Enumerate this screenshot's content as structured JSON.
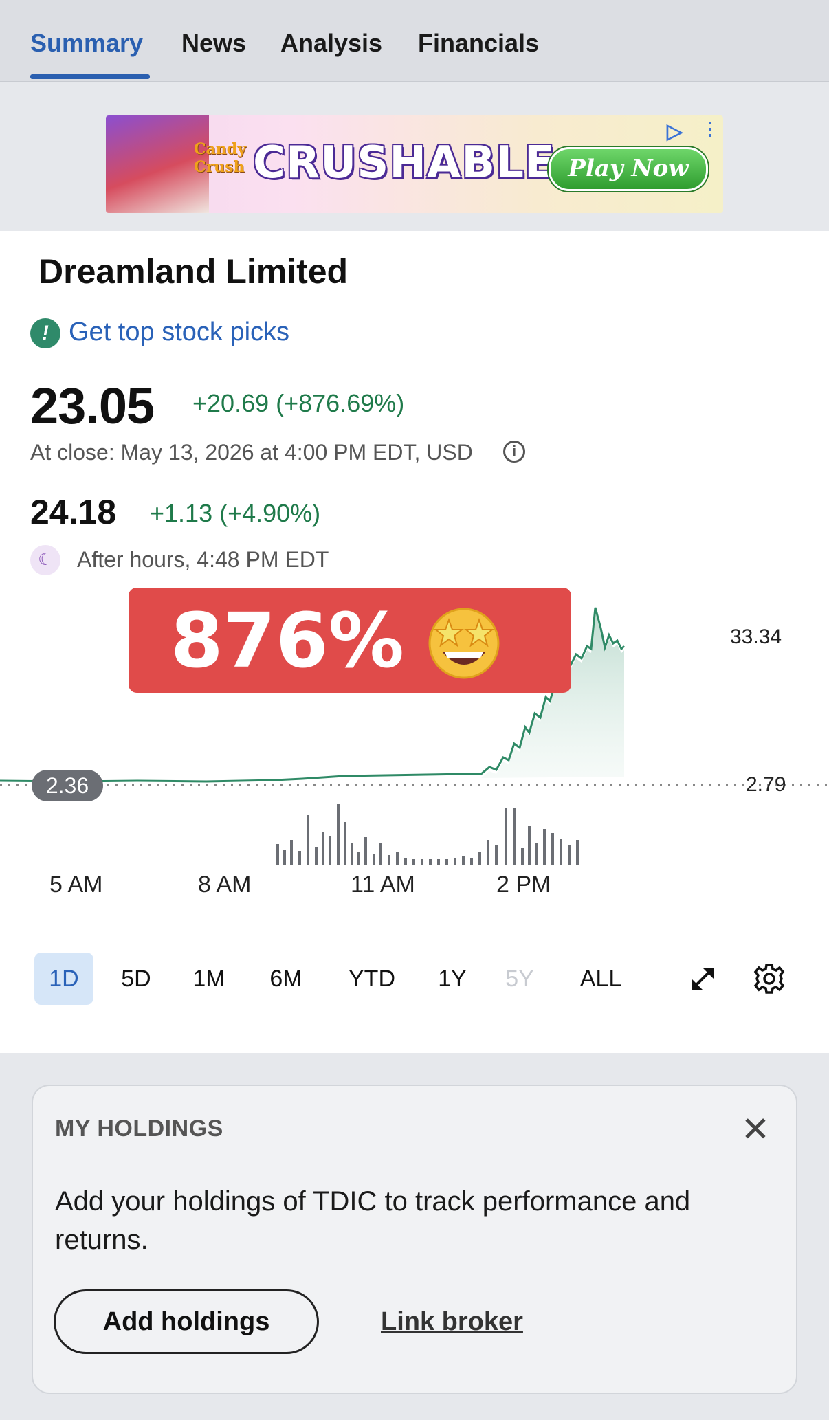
{
  "tabs": [
    "Summary",
    "News",
    "Analysis",
    "Financials"
  ],
  "ad": {
    "logo": "Candy Crush",
    "headline": "CRUSHABLE",
    "cta": "Play Now"
  },
  "stock": {
    "name": "Dreamland Limited",
    "picks_link": "Get top stock picks",
    "price": "23.05",
    "change": "+20.69 (+876.69%)",
    "close_info": "At close: May 13, 2026 at 4:00 PM EDT, USD",
    "after_hours_price": "24.18",
    "after_hours_change": "+1.13 (+4.90%)",
    "after_hours_label": "After hours, 4:48 PM EDT"
  },
  "overlay": {
    "text": "876%",
    "emoji": "star-struck-emoji"
  },
  "chart": {
    "high_label": "33.34",
    "last_label": "2.79",
    "prev_close_label": "2.36",
    "x_labels": [
      "5 AM",
      "8 AM",
      "11 AM",
      "2 PM"
    ]
  },
  "ranges": [
    {
      "label": "1D",
      "state": "active"
    },
    {
      "label": "5D",
      "state": "normal"
    },
    {
      "label": "1M",
      "state": "normal"
    },
    {
      "label": "6M",
      "state": "normal"
    },
    {
      "label": "YTD",
      "state": "normal"
    },
    {
      "label": "1Y",
      "state": "normal"
    },
    {
      "label": "5Y",
      "state": "disabled"
    },
    {
      "label": "ALL",
      "state": "normal"
    }
  ],
  "icons": {
    "expand": "expand-icon",
    "settings": "gear-icon",
    "info": "info-icon",
    "close": "close-icon",
    "after_hours": "moon-icon"
  },
  "holdings": {
    "title": "MY HOLDINGS",
    "description": "Add your holdings of TDIC to track performance and returns.",
    "add_button": "Add holdings",
    "link_broker": "Link broker"
  },
  "colors": {
    "accent": "#2a5fb0",
    "positive": "#1f7a4a",
    "banner": "#e04b4a"
  }
}
